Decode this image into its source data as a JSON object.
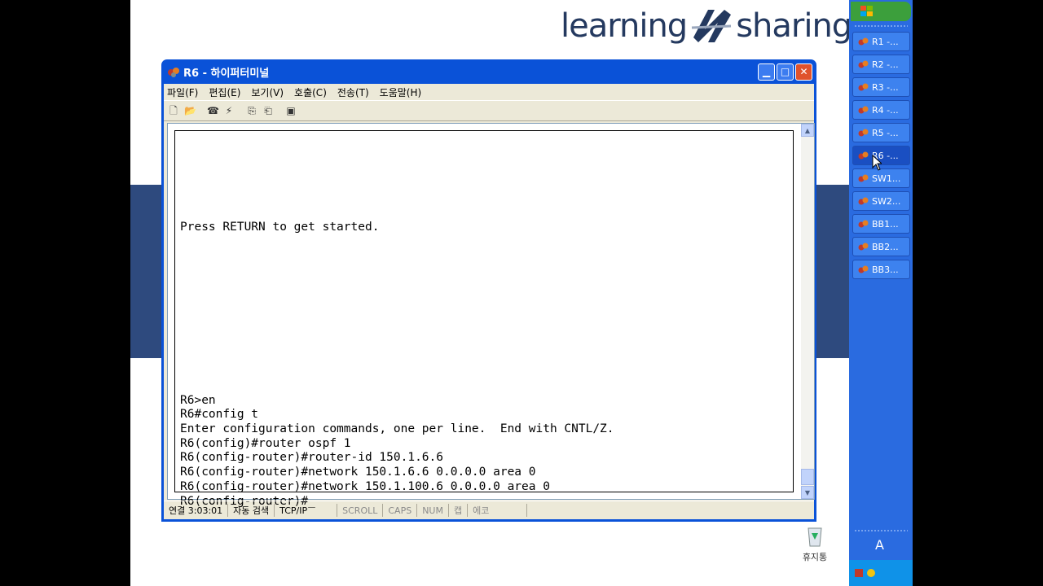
{
  "logo": {
    "left": "learning",
    "right": "sharing"
  },
  "window": {
    "title": "R6 - 하이퍼터미널",
    "menu": [
      "파일(F)",
      "편집(E)",
      "보기(V)",
      "호출(C)",
      "전송(T)",
      "도움말(H)"
    ],
    "terminal_lines": [
      "",
      "",
      "",
      "",
      "",
      "",
      "Press RETURN to get started.",
      "",
      "",
      "",
      "",
      "",
      "",
      "",
      "",
      "",
      "",
      "",
      "R6>en",
      "R6#config t",
      "Enter configuration commands, one per line.  End with CNTL/Z.",
      "R6(config)#router ospf 1",
      "R6(config-router)#router-id 150.1.6.6",
      "R6(config-router)#network 150.1.6.6 0.0.0.0 area 0",
      "R6(config-router)#network 150.1.100.6 0.0.0.0 area 0",
      "R6(config-router)#_"
    ],
    "status": {
      "connection": "연결 3:03:01",
      "detect": "자동 검색",
      "protocol": "TCP/IP",
      "scroll": "SCROLL",
      "caps": "CAPS",
      "num": "NUM",
      "cap": "캡",
      "echo": "에코"
    }
  },
  "desktop": {
    "recycle_label": "휴지통"
  },
  "taskbar": {
    "items": [
      "R1 -...",
      "R2 -...",
      "R3 -...",
      "R4 -...",
      "R5 -...",
      "R6 -...",
      "SW1...",
      "SW2...",
      "BB1...",
      "BB2...",
      "BB3..."
    ],
    "active_index": 5,
    "lang": "A"
  },
  "colors": {
    "band": "#2e4a7e",
    "taskbar": "#2a6be0",
    "title": "#0a52d8"
  }
}
